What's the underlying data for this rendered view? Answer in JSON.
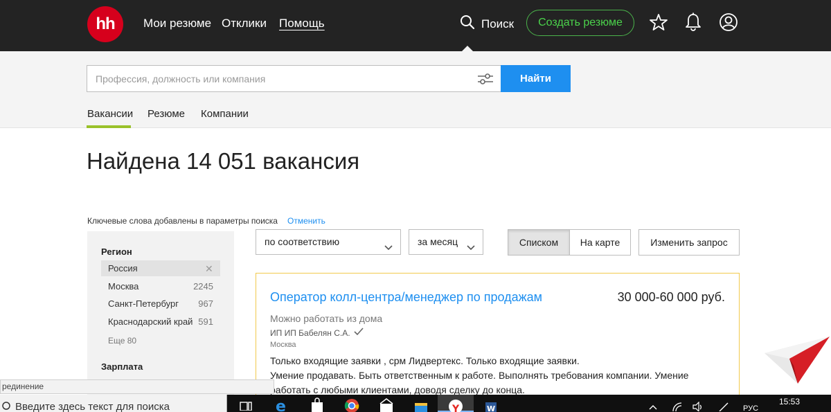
{
  "header": {
    "logo": "hh",
    "nav": [
      "Мои резюме",
      "Отклики",
      "Помощь"
    ],
    "search_label": "Поиск",
    "create_resume": "Создать резюме",
    "icons": [
      "search-icon",
      "star-icon",
      "bell-icon",
      "user-icon"
    ]
  },
  "search": {
    "placeholder": "Профессия, должность или компания",
    "button": "Найти",
    "tabs": [
      "Вакансии",
      "Резюме",
      "Компании"
    ]
  },
  "results": {
    "title": "Найдена 14 051 вакансия",
    "keywords_note": "Ключевые слова добавлены в параметры поиска",
    "cancel": "Отменить"
  },
  "sidebar": {
    "region_heading": "Регион",
    "selected_region": "Россия",
    "regions": [
      {
        "name": "Москва",
        "count": "2245"
      },
      {
        "name": "Санкт-Петербург",
        "count": "967"
      },
      {
        "name": "Краснодарский край",
        "count": "591"
      }
    ],
    "more": "Еще 80",
    "salary_heading": "Зарплата"
  },
  "controls": {
    "sort": "по соответствию",
    "period": "за месяц",
    "view_list": "Списком",
    "view_map": "На карте",
    "change_query": "Изменить запрос"
  },
  "vacancy": {
    "title": "Оператор колл-центра/менеджер по продажам",
    "salary": "30 000-60 000 руб.",
    "remote": "Можно работать из дома",
    "company": "ИП ИП Бабелян С.А.",
    "city": "Москва",
    "desc_lines": [
      "Только входящие заявки , срм Лидвертекс. Только входящие заявки.",
      "Умение продавать. Быть ответственным к работе. Выполнять требования компании. Умение",
      "работать с любыми клиентами, доводя сделку до конца."
    ]
  },
  "tooltip": "рединение",
  "taskbar": {
    "search_placeholder": "Введите здесь текст для поиска",
    "lang": "РУС",
    "time": "15:53"
  },
  "colors": {
    "topbar": "#232323",
    "brand_red": "#d6001c",
    "accent_blue": "#1e8ff0",
    "create_green": "#4bd34b",
    "tab_underline": "#9ac12a",
    "card_border": "#f2c94c"
  }
}
